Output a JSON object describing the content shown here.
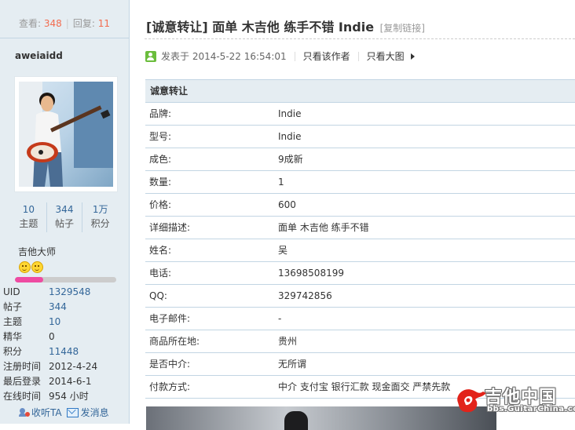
{
  "sidebar": {
    "views_label": "查看:",
    "views_value": "348",
    "replies_label": "回复:",
    "replies_value": "11",
    "username": "aweiaidd",
    "stats": [
      {
        "value": "10",
        "label": "主题"
      },
      {
        "value": "344",
        "label": "帖子"
      },
      {
        "value": "1万",
        "label": "积分"
      }
    ],
    "rank": "吉他大师",
    "level_progress": 0.28,
    "info": [
      {
        "key": "UID",
        "value": "1329548",
        "link": true
      },
      {
        "key": "帖子",
        "value": "344",
        "link": true
      },
      {
        "key": "主题",
        "value": "10",
        "link": true
      },
      {
        "key": "精华",
        "value": "0",
        "link": false
      },
      {
        "key": "积分",
        "value": "11448",
        "link": true
      },
      {
        "key": "注册时间",
        "value": "2012-4-24",
        "link": false
      },
      {
        "key": "最后登录",
        "value": "2014-6-1",
        "link": false
      },
      {
        "key": "在线时间",
        "value": "954 小时",
        "link": false
      }
    ],
    "actions": {
      "follow": "收听TA",
      "message": "发消息"
    }
  },
  "post": {
    "title": "[诚意转让] 面单 木吉他 练手不错 Indie",
    "copy_link": "[复制链接]",
    "posted_at": "发表于 2014-5-22 16:54:01",
    "author_only": "只看该作者",
    "big_image": "只看大图"
  },
  "table": {
    "header": "诚意转让",
    "rows": [
      {
        "key": "品牌:",
        "value": "Indie"
      },
      {
        "key": "型号:",
        "value": "Indie"
      },
      {
        "key": "成色:",
        "value": "9成新"
      },
      {
        "key": "数量:",
        "value": "1"
      },
      {
        "key": "价格:",
        "value": "600"
      },
      {
        "key": "详细描述:",
        "value": "面单 木吉他 练手不错"
      },
      {
        "key": "姓名:",
        "value": "吴"
      },
      {
        "key": "电话:",
        "value": "13698508199"
      },
      {
        "key": "QQ:",
        "value": "329742856"
      },
      {
        "key": "电子邮件:",
        "value": "-"
      },
      {
        "key": "商品所在地:",
        "value": "贵州"
      },
      {
        "key": "是否中介:",
        "value": "无所谓"
      },
      {
        "key": "付款方式:",
        "value": "中介 支付宝 银行汇款 现金面交 严禁先款"
      }
    ]
  },
  "watermark": {
    "title": "吉他中国",
    "url": "bbs.GuitarChina.com"
  },
  "colors": {
    "sidebar_bg": "#e5edf2",
    "border": "#c2d5e3",
    "link": "#336699",
    "count_accent": "#f26c4f",
    "progress": "#ee4ba2"
  }
}
